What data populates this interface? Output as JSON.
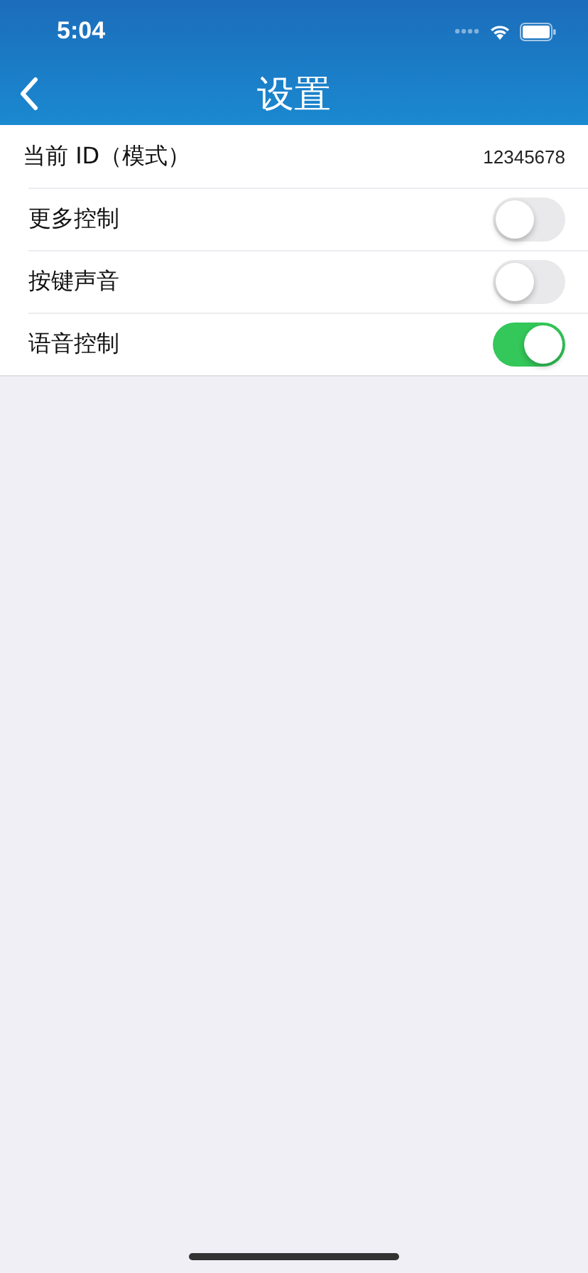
{
  "status_bar": {
    "time": "5:04"
  },
  "nav": {
    "title": "设置"
  },
  "rows": [
    {
      "kind": "value",
      "label": "当前 ID（模式）",
      "value": "12345678"
    },
    {
      "kind": "toggle",
      "label": "更多控制",
      "on": false
    },
    {
      "kind": "toggle",
      "label": "按键声音",
      "on": false
    },
    {
      "kind": "toggle",
      "label": "语音控制",
      "on": true
    }
  ]
}
